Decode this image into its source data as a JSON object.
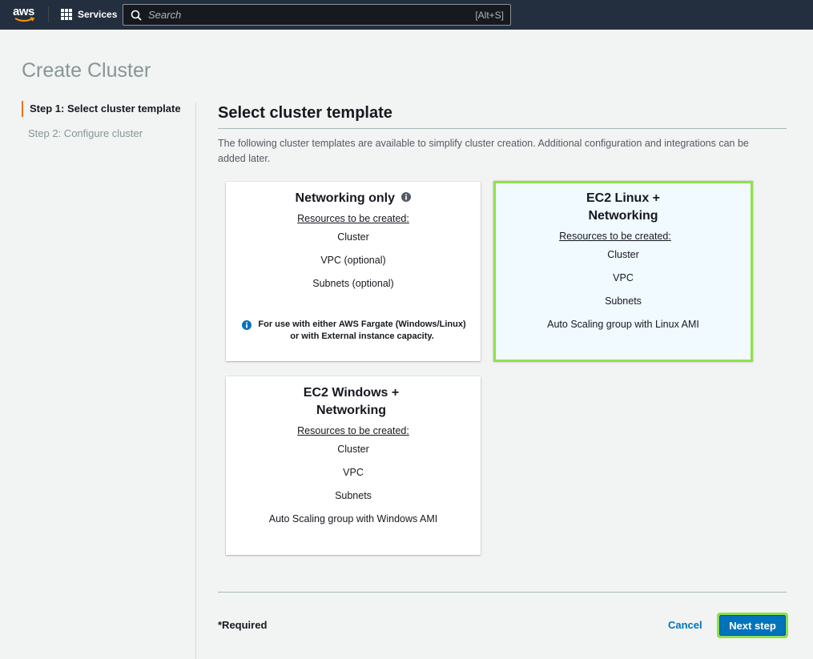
{
  "topbar": {
    "logo_text": "aws",
    "services_label": "Services",
    "search_placeholder": "Search",
    "search_shortcut": "[Alt+S]"
  },
  "page": {
    "title": "Create Cluster"
  },
  "steps": [
    {
      "label": "Step 1: Select cluster template",
      "active": true
    },
    {
      "label": "Step 2: Configure cluster",
      "active": false
    }
  ],
  "section": {
    "title": "Select cluster template",
    "description": "The following cluster templates are available to simplify cluster creation. Additional configuration and integrations can be added later."
  },
  "templates": [
    {
      "title": "Networking only",
      "resources_label": "Resources to be created:",
      "items": [
        "Cluster",
        "VPC (optional)",
        "Subnets (optional)"
      ],
      "note": "For use with either AWS Fargate (Windows/Linux) or with External instance capacity.",
      "selected": false
    },
    {
      "title_line1": "EC2 Linux +",
      "title_line2": "Networking",
      "resources_label": "Resources to be created:",
      "items": [
        "Cluster",
        "VPC",
        "Subnets",
        "Auto Scaling group with Linux AMI"
      ],
      "selected": true
    },
    {
      "title_line1": "EC2 Windows +",
      "title_line2": "Networking",
      "resources_label": "Resources to be created:",
      "items": [
        "Cluster",
        "VPC",
        "Subnets",
        "Auto Scaling group with Windows AMI"
      ],
      "selected": false
    }
  ],
  "footer": {
    "required_label": "*Required",
    "cancel_label": "Cancel",
    "next_label": "Next step"
  },
  "colors": {
    "header_bg": "#232f3e",
    "accent_orange": "#ec7211",
    "primary_blue": "#0073bb",
    "highlight_green": "#8fe04b",
    "selected_card_bg": "#f1faff"
  }
}
